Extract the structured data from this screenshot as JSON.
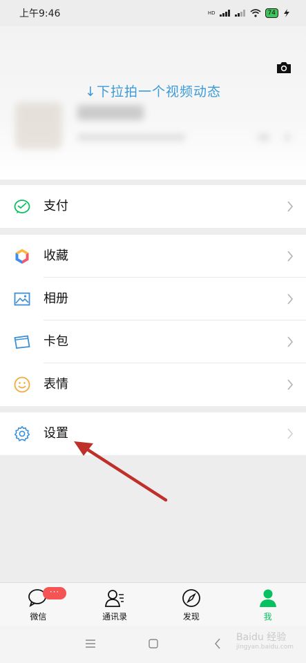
{
  "status_bar": {
    "time": "上午9:46",
    "battery": "74",
    "network_badge": "HD"
  },
  "header": {
    "pull_hint": "↓下拉拍一个视频动态",
    "camera_icon": "camera-icon"
  },
  "menu": {
    "pay": {
      "label": "支付",
      "icon": "wechat-pay-icon"
    },
    "main": [
      {
        "label": "收藏",
        "icon": "favorites-cube-icon"
      },
      {
        "label": "相册",
        "icon": "album-image-icon"
      },
      {
        "label": "卡包",
        "icon": "card-wallet-icon"
      },
      {
        "label": "表情",
        "icon": "sticker-smile-icon"
      }
    ],
    "settings": {
      "label": "设置",
      "icon": "gear-icon"
    }
  },
  "tabs": [
    {
      "label": "微信",
      "icon": "chat-bubble-icon",
      "badge": "···"
    },
    {
      "label": "通讯录",
      "icon": "contacts-icon"
    },
    {
      "label": "发现",
      "icon": "compass-icon"
    },
    {
      "label": "我",
      "icon": "person-icon",
      "active": true
    }
  ],
  "nav": {
    "menu_icon": "nav-menu-icon",
    "home_icon": "nav-home-icon",
    "back_icon": "nav-back-icon"
  },
  "watermark": {
    "logo": "Baidu 经验",
    "url": "jingyan.baidu.com"
  },
  "colors": {
    "accent_green": "#07c160",
    "hint_blue": "#3c9ad8",
    "annotation_red": "#c0302a"
  }
}
